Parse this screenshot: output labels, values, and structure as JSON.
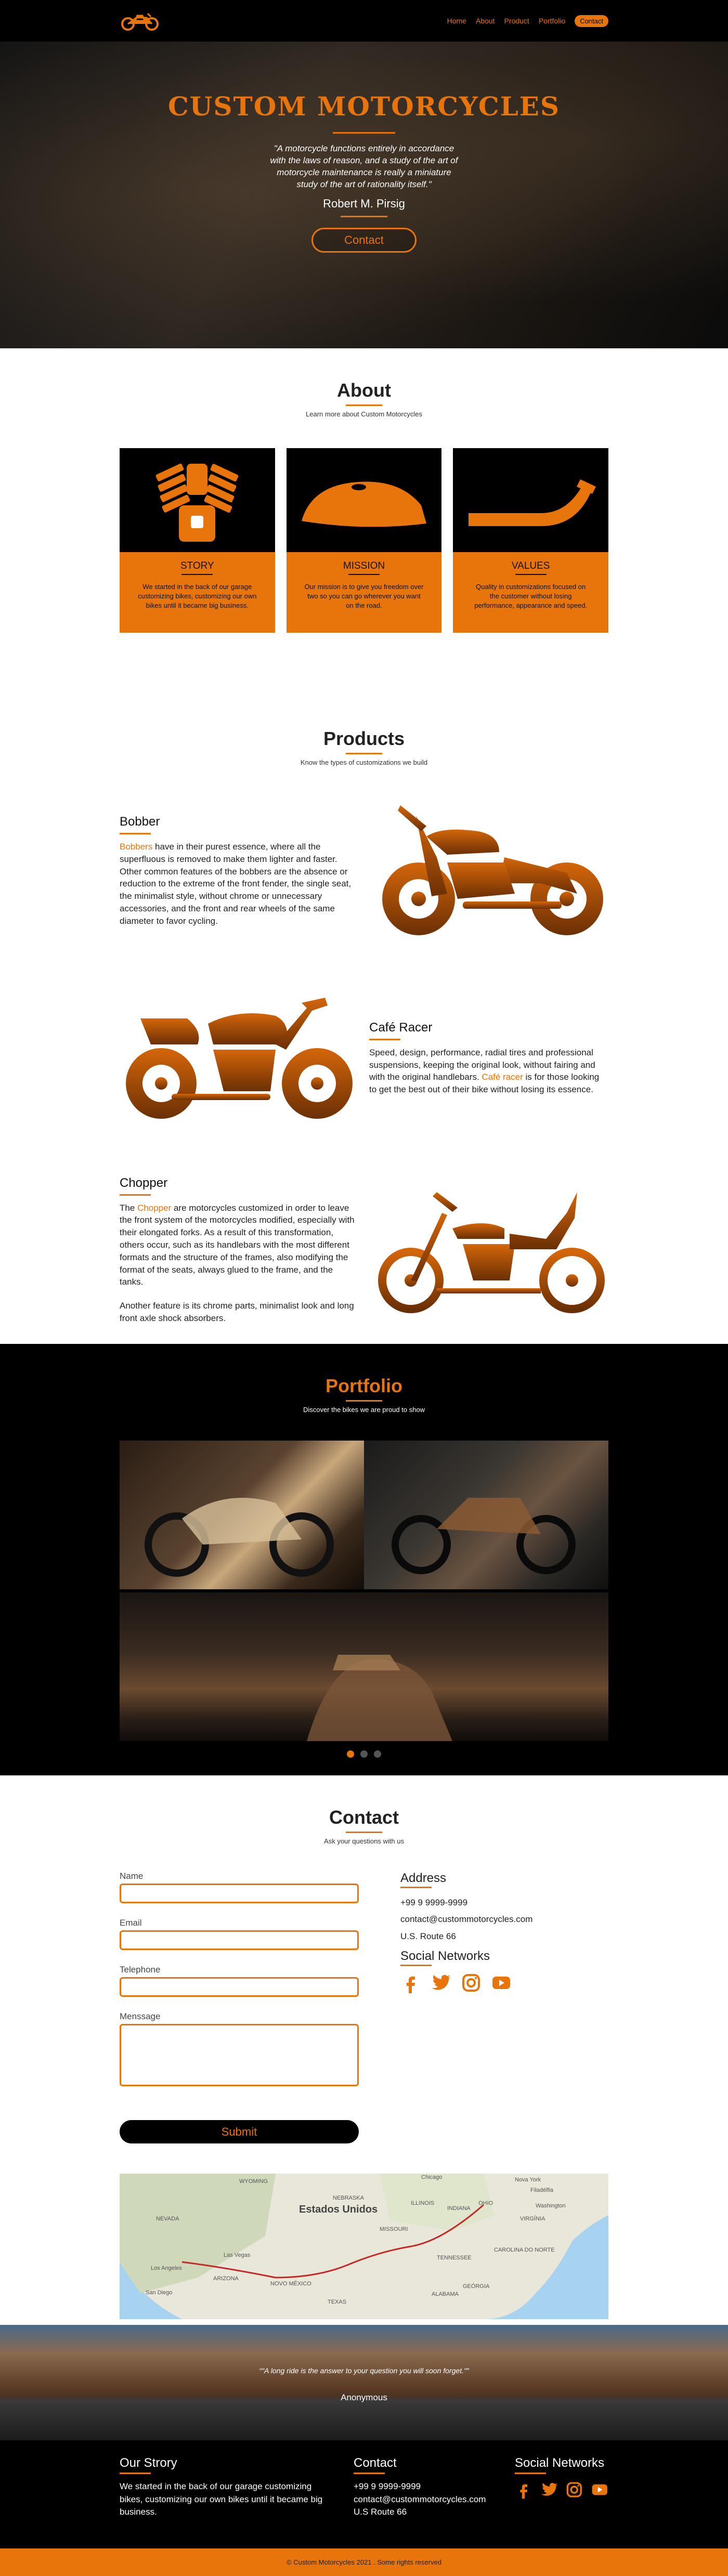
{
  "nav": {
    "logo_icon": "motorcycle-icon",
    "items": [
      "Home",
      "About",
      "Product",
      "Portfolio"
    ],
    "contact_button": "Contact"
  },
  "hero": {
    "title": "CUSTOM MOTORCYCLES",
    "quote": "\"A motorcycle functions entirely in accordance with the laws of reason, and a study of the art of motorcycle maintenance is really a miniature study of the art of rationality itself.\"",
    "author": "Robert M. Pirsig",
    "cta": "Contact"
  },
  "about": {
    "title": "About",
    "subtitle": "Learn more about Custom Motorcycles",
    "cards": [
      {
        "icon": "engine-icon",
        "title": "STORY",
        "text": "We started in the back of our garage customizing bikes, customizing our own bikes until it became big business."
      },
      {
        "icon": "fuel-tank-icon",
        "title": "MISSION",
        "text": "Our mission is to give you freedom over two so you can go wherever you want on the road."
      },
      {
        "icon": "exhaust-icon",
        "title": "VALUES",
        "text": "Quality in customizations focused on the customer without losing performance, appearance and speed."
      }
    ]
  },
  "products": {
    "title": "Products",
    "subtitle": "Know the types of customizations we build",
    "items": [
      {
        "name": "Bobber",
        "link": "Bobbers",
        "text": " have in their purest essence, where all the superfluous is removed to make them lighter and faster. Other common features of the bobbers are the absence or reduction to the extreme of the front fender, the single seat, the minimalist style, without chrome or unnecessary accessories, and the front and rear wheels of the same diameter to favor cycling."
      },
      {
        "name": "Café Racer",
        "text_before": "Speed, design, performance, radial tires and professional suspensions, keeping the original look, without fairing and with the original handlebars. ",
        "link": "Café racer",
        "text_after": " is for those looking to get the best out of their bike without losing its essence."
      },
      {
        "name": "Chopper",
        "text_before": "The ",
        "link": "Chopper",
        "text_after": " are motorcycles customized in order to leave the front system of the motorcycles modified, especially with their elongated forks. As a result of this transformation, others occur, such as its handlebars with the most different formats and the structure of the frames, also modifying the format of the seats, always glued to the frame, and the tanks.",
        "text2": "Another feature is its chrome parts, minimalist look and long front axle shock absorbers."
      }
    ]
  },
  "portfolio": {
    "title": "Portfolio",
    "subtitle": "Discover the bikes we are proud to show",
    "active_slide": 1,
    "slides": 3
  },
  "contact": {
    "title": "Contact",
    "subtitle": "Ask your questions with us",
    "form": {
      "name": "Name",
      "email": "Email",
      "telephone": "Telephone",
      "message": "Menssage",
      "submit": "Submit"
    },
    "address": {
      "title": "Address",
      "phone": "+99 9 9999-9999",
      "email": "contact@custommotorcycles.com",
      "street": "U.S. Route 66"
    },
    "social": {
      "title": "Social Networks",
      "icons": [
        "facebook-icon",
        "twitter-icon",
        "instagram-icon",
        "youtube-icon"
      ]
    },
    "map": {
      "country": "Estados Unidos",
      "labels": [
        "WYOMING",
        "NEBRASKA",
        "NEVADA",
        "Chicago",
        "Nova York",
        "Las Vegas",
        "Los Angeles",
        "San Diego",
        "NOVO MÉXICO",
        "ARIZONA",
        "TEXAS",
        "MISSOURI",
        "ILLINOIS",
        "INDIANA",
        "OHIO",
        "VIRGÍNIA",
        "TENNESSEE",
        "CAROLINA DO NORTE",
        "GEÓRGIA",
        "ALABAMA",
        "Washington",
        "Filadélfia"
      ]
    }
  },
  "testimonial": {
    "quote": "\"A long ride is the answer to your question you will soon forget.\"",
    "author": "Anonymous"
  },
  "footer": {
    "story_title": "Our Strory",
    "story": "We started in the back of our garage customizing bikes, customizing our own bikes until it became big business.",
    "contact_title": "Contact",
    "phone": "+99 9 9999-9999",
    "email": "contact@custommotorcycles.com",
    "street": "U.S Route 66",
    "social_title": "Social Networks",
    "copyright": "© Custom Motorcycles 2021 . Some rights reserved"
  },
  "colors": {
    "accent": "#e8740c",
    "dark": "#000000"
  }
}
